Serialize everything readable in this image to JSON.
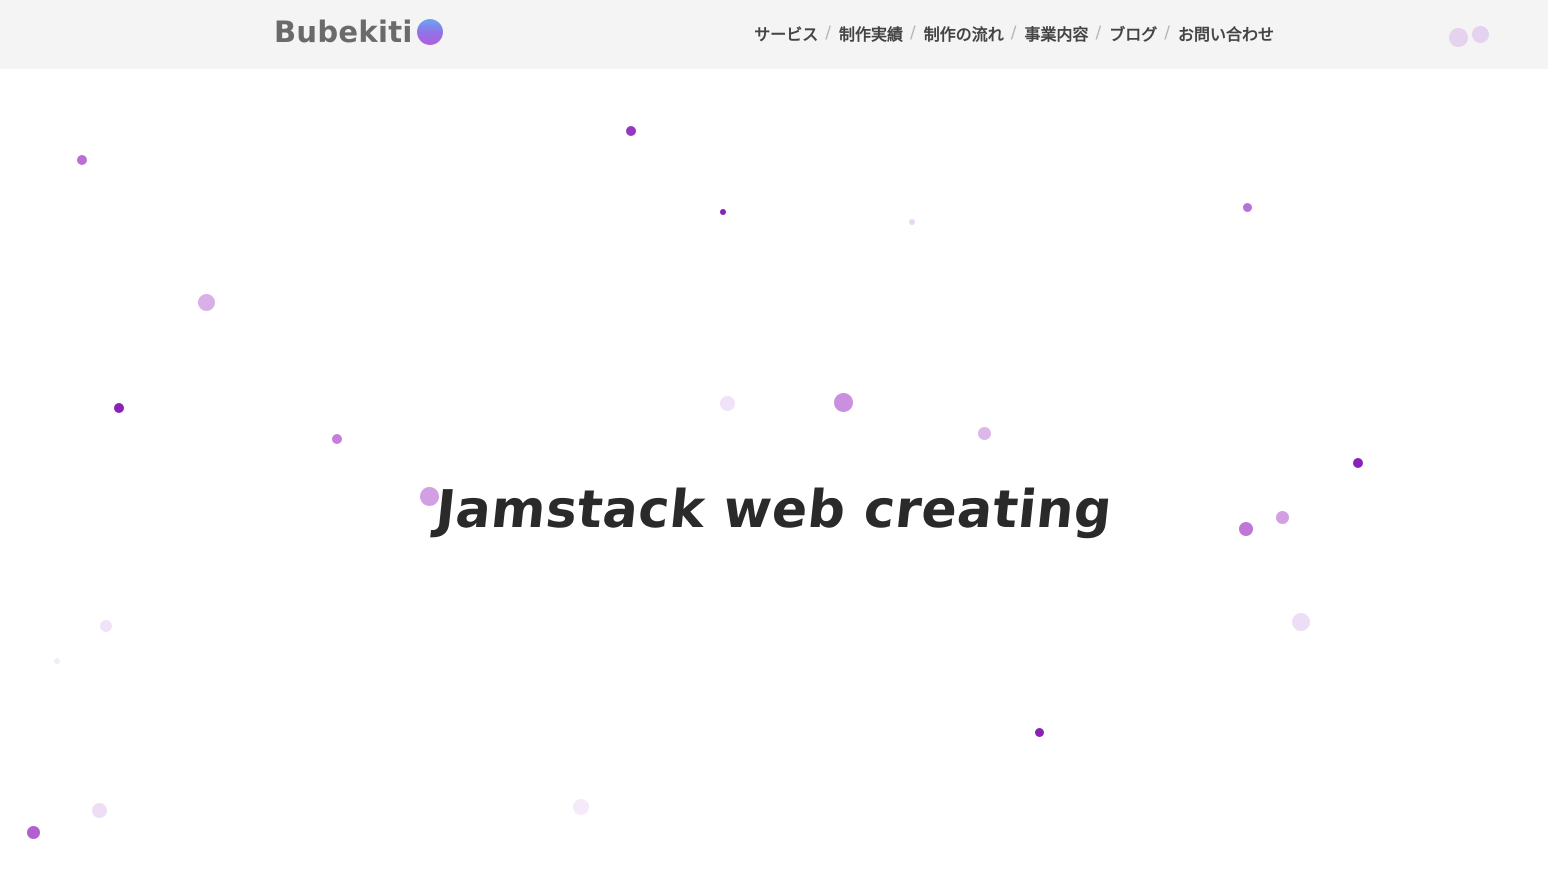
{
  "header": {
    "logo_text": "Bubekiti",
    "nav": [
      {
        "label": "サービス"
      },
      {
        "label": "制作実績"
      },
      {
        "label": "制作の流れ"
      },
      {
        "label": "事業内容"
      },
      {
        "label": "ブログ"
      },
      {
        "label": "お問い合わせ"
      }
    ],
    "separator": "/"
  },
  "hero": {
    "title": "Jamstack web creating"
  },
  "colors": {
    "header_bg": "#f4f4f4",
    "title": "#2a2a2a",
    "nav_text": "#444444",
    "particle_dark": "#8a22b8",
    "particle_mid": "#b45fd0",
    "particle_light": "#e9d6f3",
    "logo_orb": [
      "#6aa6f3",
      "#8f74e6",
      "#b25ee0"
    ]
  }
}
